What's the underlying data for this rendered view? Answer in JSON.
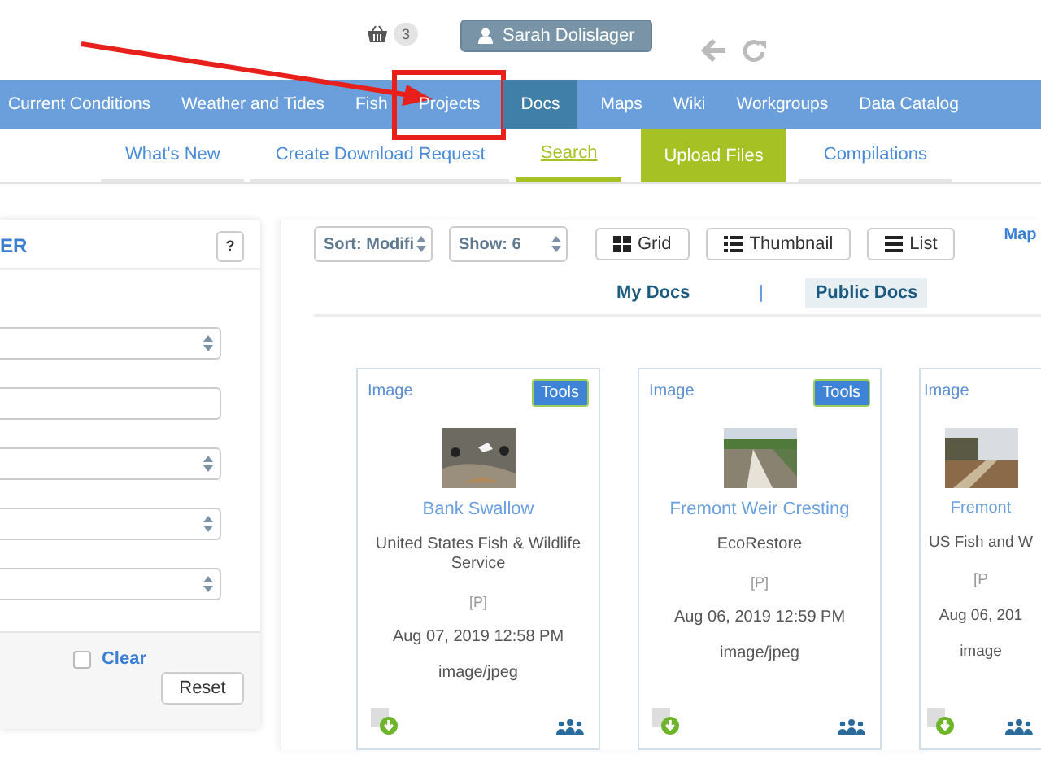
{
  "header": {
    "cart_count": "3",
    "user": "Sarah Dolislager"
  },
  "nav": [
    {
      "label": "Current Conditions",
      "selected": false,
      "highlighted": false
    },
    {
      "label": "Weather and Tides",
      "selected": false,
      "highlighted": false
    },
    {
      "label": "Fish",
      "selected": false,
      "highlighted": false
    },
    {
      "label": "Projects",
      "selected": false,
      "highlighted": true
    },
    {
      "label": "Docs",
      "selected": true,
      "highlighted": false
    },
    {
      "label": "Maps",
      "selected": false,
      "highlighted": false
    },
    {
      "label": "Wiki",
      "selected": false,
      "highlighted": false
    },
    {
      "label": "Workgroups",
      "selected": false,
      "highlighted": false
    },
    {
      "label": "Data Catalog",
      "selected": false,
      "highlighted": false
    }
  ],
  "subnav": [
    {
      "label": "What's New",
      "kind": "link",
      "selected": false
    },
    {
      "label": "Create Download Request",
      "kind": "link",
      "selected": false
    },
    {
      "label": "Search",
      "kind": "link",
      "selected": true
    },
    {
      "label": "Upload Files",
      "kind": "button",
      "selected": false
    },
    {
      "label": "Compilations",
      "kind": "link",
      "selected": false
    }
  ],
  "filter": {
    "title": "ER",
    "help": "?",
    "fields": [
      {
        "kind": "select"
      },
      {
        "kind": "input"
      },
      {
        "kind": "select"
      },
      {
        "kind": "select"
      },
      {
        "kind": "select"
      }
    ],
    "clear": {
      "label": "Clear",
      "checked": false
    },
    "reset": "Reset"
  },
  "toolbar": {
    "sort": "Sort: Modifi",
    "show": "Show: 6",
    "views": [
      {
        "label": "Grid",
        "kind": "grid"
      },
      {
        "label": "Thumbnail",
        "kind": "thumbnail"
      },
      {
        "label": "List",
        "kind": "list"
      }
    ],
    "map": "Map"
  },
  "doc_tabs": {
    "separator": "|",
    "tabs": [
      {
        "label": "My Docs",
        "selected": false
      },
      {
        "label": "Public Docs",
        "selected": true
      }
    ]
  },
  "cards": [
    {
      "type": "Image",
      "tools": "Tools",
      "title": "Bank Swallow",
      "source": "United States Fish & Wildlife Service",
      "flag": "[P]",
      "date": "Aug 07, 2019 12:58 PM",
      "mime": "image/jpeg"
    },
    {
      "type": "Image",
      "tools": "Tools",
      "title": "Fremont Weir Cresting",
      "source": "EcoRestore",
      "flag": "[P]",
      "date": "Aug 06, 2019 12:59 PM",
      "mime": "image/jpeg"
    },
    {
      "type": "Image",
      "title": "Fremont",
      "source": "US Fish and W",
      "flag": "[P",
      "date": "Aug 06, 201",
      "mime": "image"
    }
  ]
}
